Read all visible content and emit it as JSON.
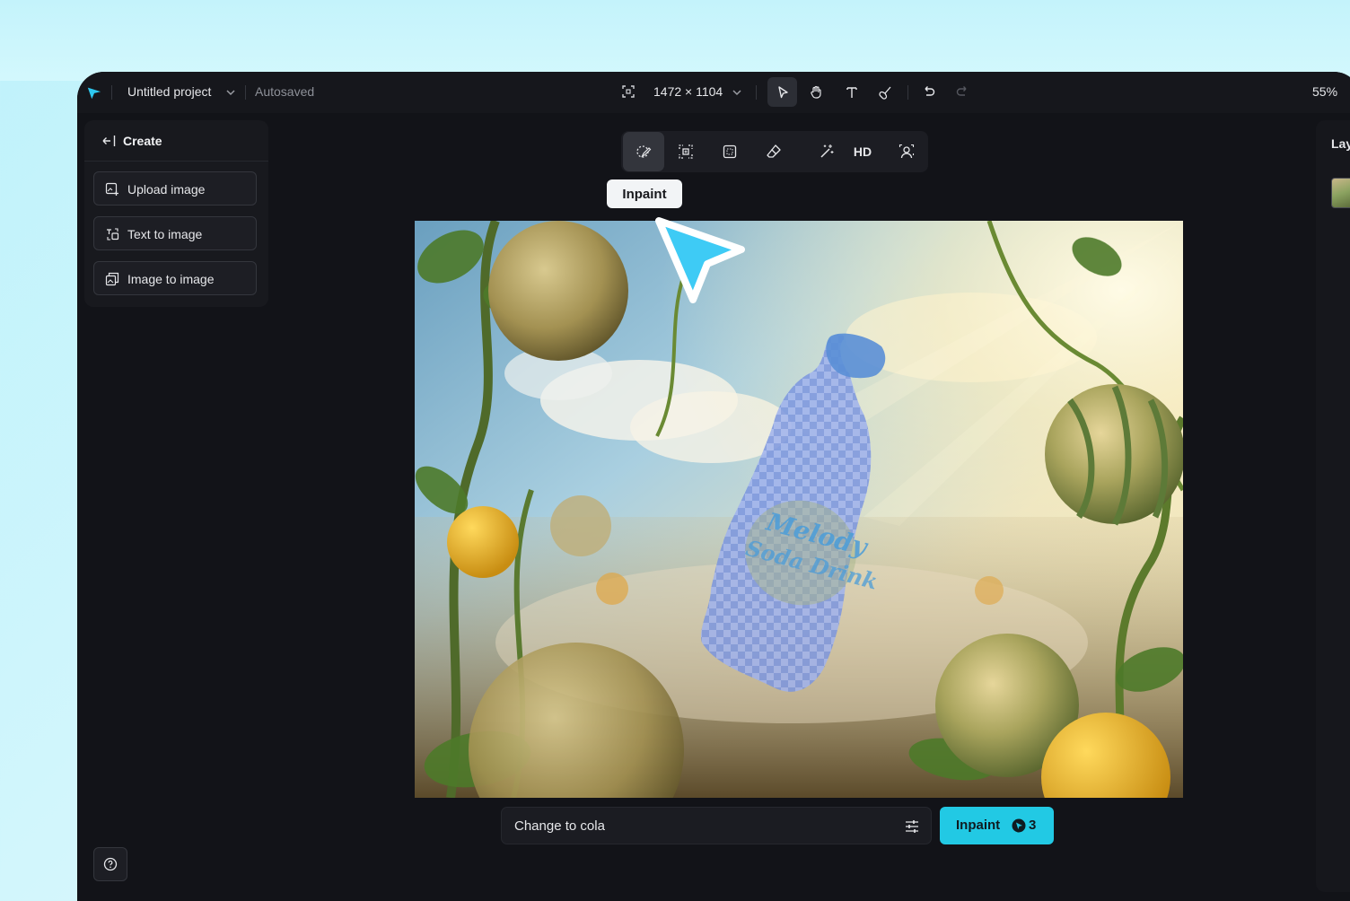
{
  "topbar": {
    "project_name": "Untitled project",
    "save_status": "Autosaved",
    "canvas_size": "1472 × 1104",
    "zoom": "55%"
  },
  "left_panel": {
    "header": "Create",
    "items": [
      {
        "label": "Upload image",
        "icon": "upload-image-icon"
      },
      {
        "label": "Text to image",
        "icon": "text-to-image-icon"
      },
      {
        "label": "Image to image",
        "icon": "image-to-image-icon"
      }
    ]
  },
  "canvas_toolbar": {
    "tools": [
      "inpaint",
      "expand",
      "crop",
      "eraser",
      "magic-wand",
      "HD",
      "remove-background"
    ],
    "hd_label": "HD",
    "tooltip": "Inpaint"
  },
  "image": {
    "bottle_label_line1": "Melody",
    "bottle_label_line2": "Soda Drink"
  },
  "prompt": {
    "value": "Change to cola",
    "button_label": "Inpaint",
    "credits": "3"
  },
  "right_panel": {
    "title": "Lay"
  },
  "colors": {
    "accent": "#22c9e4",
    "background": "#121318",
    "panel": "#18191e"
  }
}
